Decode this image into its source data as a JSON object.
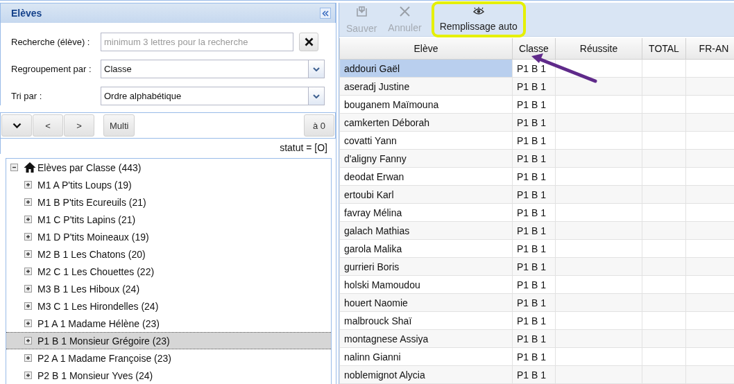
{
  "left_panel": {
    "title": "Elèves",
    "search": {
      "label": "Recherche (élève) :",
      "placeholder": "minimum 3 lettres pour la recherche"
    },
    "grouping": {
      "label": "Regroupement par :",
      "value": "Classe"
    },
    "sort": {
      "label": "Tri par :",
      "value": "Ordre alphabétique"
    },
    "toolbar": [
      {
        "kind": "chevron"
      },
      {
        "kind": "text",
        "label": "<"
      },
      {
        "kind": "text",
        "label": ">"
      },
      {
        "kind": "text",
        "label": "Multi"
      },
      {
        "kind": "text",
        "label": "à 0"
      }
    ],
    "status": "statut = [O]",
    "tree": {
      "label": "Elèves par Classe (443)",
      "expanded": true,
      "children": [
        {
          "label": "M1 A P'tits Loups (19)",
          "expanded": false,
          "selected": false
        },
        {
          "label": "M1 B P'tits Ecureuils (21)",
          "expanded": false,
          "selected": false
        },
        {
          "label": "M1 C P'tits Lapins (21)",
          "expanded": false,
          "selected": false
        },
        {
          "label": "M1 D P'tits Moineaux (19)",
          "expanded": false,
          "selected": false
        },
        {
          "label": "M2 B 1 Les Chatons (20)",
          "expanded": false,
          "selected": false
        },
        {
          "label": "M2 C 1 Les Chouettes (22)",
          "expanded": false,
          "selected": false
        },
        {
          "label": "M3 B 1 Les Hiboux (24)",
          "expanded": false,
          "selected": false
        },
        {
          "label": "M3 C 1 Les Hirondelles (24)",
          "expanded": false,
          "selected": false
        },
        {
          "label": "P1 A 1 Madame Hélène (23)",
          "expanded": false,
          "selected": false
        },
        {
          "label": "P1 B 1 Monsieur Grégoire (23)",
          "expanded": false,
          "selected": true
        },
        {
          "label": "P2 A 1 Madame Françoise (23)",
          "expanded": false,
          "selected": false
        },
        {
          "label": "P2 B 1 Monsieur Yves (24)",
          "expanded": false,
          "selected": false
        }
      ]
    }
  },
  "right_panel": {
    "toolbar": [
      {
        "kind": "save",
        "label": "Sauver",
        "disabled": true,
        "highlighted": false
      },
      {
        "kind": "cancel",
        "label": "Annuler",
        "disabled": true,
        "highlighted": false
      },
      {
        "kind": "eye",
        "label": "Remplissage auto",
        "disabled": false,
        "highlighted": true
      }
    ],
    "table": {
      "columns": [
        "Elève",
        "Classe",
        "Réussite",
        "TOTAL",
        "FR-AN"
      ],
      "rows": [
        {
          "eleve": "addouri Gaël",
          "classe": "P1 B 1",
          "selected": true
        },
        {
          "eleve": "aseradj Justine",
          "classe": "P1 B 1",
          "selected": false
        },
        {
          "eleve": "bouganem Maïmouna",
          "classe": "P1 B 1",
          "selected": false
        },
        {
          "eleve": "camkerten Déborah",
          "classe": "P1 B 1",
          "selected": false
        },
        {
          "eleve": "covatti Yann",
          "classe": "P1 B 1",
          "selected": false
        },
        {
          "eleve": "d'aligny Fanny",
          "classe": "P1 B 1",
          "selected": false
        },
        {
          "eleve": "deodat Erwan",
          "classe": "P1 B 1",
          "selected": false
        },
        {
          "eleve": "ertoubi Karl",
          "classe": "P1 B 1",
          "selected": false
        },
        {
          "eleve": "favray Mélina",
          "classe": "P1 B 1",
          "selected": false
        },
        {
          "eleve": "galach Mathias",
          "classe": "P1 B 1",
          "selected": false
        },
        {
          "eleve": "garola Malika",
          "classe": "P1 B 1",
          "selected": false
        },
        {
          "eleve": "gurrieri Boris",
          "classe": "P1 B 1",
          "selected": false
        },
        {
          "eleve": "holski Mamoudou",
          "classe": "P1 B 1",
          "selected": false
        },
        {
          "eleve": "houert Naomie",
          "classe": "P1 B 1",
          "selected": false
        },
        {
          "eleve": "malbrouck Shaï",
          "classe": "P1 B 1",
          "selected": false
        },
        {
          "eleve": "montagnese Assiya",
          "classe": "P1 B 1",
          "selected": false
        },
        {
          "eleve": "nalinn Gianni",
          "classe": "P1 B 1",
          "selected": false
        },
        {
          "eleve": "noblemignot Alycia",
          "classe": "P1 B 1",
          "selected": false
        }
      ]
    }
  }
}
